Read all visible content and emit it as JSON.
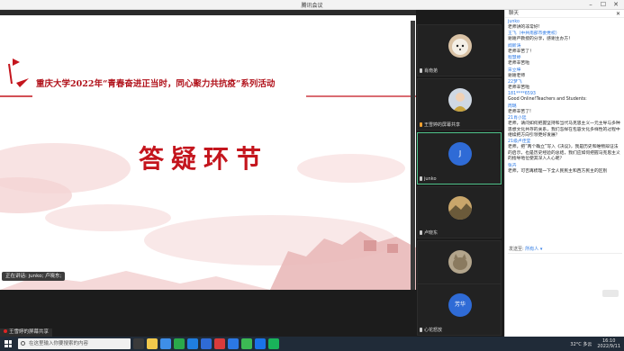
{
  "window": {
    "title": "腾讯会议",
    "controls": [
      "–",
      "☐",
      "✕"
    ]
  },
  "slide": {
    "heading": "重庆大学2022年“青春奋进正当时，同心聚力共抗疫”系列活动",
    "qa_title": "答疑环节"
  },
  "speaking": "正在讲话: junko; 卢晓东;",
  "share_bar": "王雪婷的屏幕共享",
  "participants": [
    {
      "name": "肖南弟",
      "avatar": "dog-photo"
    },
    {
      "name": "王雪婷的屏幕共享",
      "avatar": "person-photo"
    },
    {
      "name": "junko",
      "avatar": "J",
      "color": "#2f6bd6"
    },
    {
      "name": "卢晓东",
      "avatar": "landscape-photo"
    },
    {
      "name": "刘迎",
      "avatar": "cat-photo"
    },
    {
      "name": "心花怒放",
      "avatar": "芳华",
      "color": "#2f6bd6"
    }
  ],
  "chat": {
    "title": "聊天",
    "messages": [
      {
        "sender": "junko",
        "text": "老师讲的非常好!"
      },
      {
        "sender": "王飞（中共南部市委党校）",
        "text": "谢谢严教授的分享，感谢主办方！"
      },
      {
        "sender": "闻新涛",
        "text": "老师辛苦了！"
      },
      {
        "sender": "程慧婷",
        "text": "老师辛苦啦"
      },
      {
        "sender": "宋立坤",
        "text": "谢谢老师"
      },
      {
        "sender": "22梦飞",
        "text": "老师辛苦啦"
      },
      {
        "sender": "181****6593",
        "text": "Good Online!Teachers and Students:"
      },
      {
        "sender": "周璐",
        "text": "老师辛苦了!"
      },
      {
        "sender": "21肖小廷",
        "text": "老师，请问如何把握坚持和当代马克思主义一元主导与多种思想文化共存的关系，我们怎样在包容文化多样性的过程中继续把方向引领更好发展？"
      },
      {
        "sender": "21级卢佳莹",
        "text": "老师，把“两个确立”写入《决议》，我是历史和唯物辩证法的启示，也是历史经验的总结，我们应如何把握马克思主义的指导地位使其深入人心呢？"
      },
      {
        "sender": "张卉",
        "text": "老师，可否再梳理一下全人民民主和西方民主的区别"
      }
    ],
    "send_to_label": "发送至:",
    "send_to_value": "所有人 ▾"
  },
  "taskbar": {
    "search_placeholder": "在这里输入你要搜索的内容",
    "weather": "32°C 多云",
    "time": "16:10",
    "date": "2022/9/11",
    "app_colors": [
      "#3a3a3a",
      "#f2c94c",
      "#3e8ee8",
      "#2aa84a",
      "#1f7ee0",
      "#2f6bd6",
      "#d93b3b",
      "#2b78e4",
      "#3cba54",
      "#1a73e8",
      "#19b35a"
    ]
  }
}
